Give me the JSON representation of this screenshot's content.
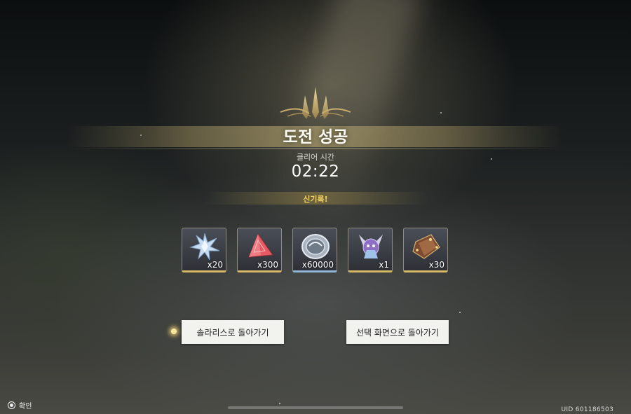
{
  "result": {
    "title": "도전 성공",
    "clear_label": "클리어 시간",
    "clear_time": "02:22",
    "record": "신기록!"
  },
  "rewards": [
    {
      "icon": "star-crystal-icon",
      "qty": "x20"
    },
    {
      "icon": "red-pyramid-crystal-icon",
      "qty": "x300"
    },
    {
      "icon": "silver-coin-icon",
      "qty": "x60000"
    },
    {
      "icon": "crystal-beast-icon",
      "qty": "x1"
    },
    {
      "icon": "brown-pouch-icon",
      "qty": "x30"
    }
  ],
  "buttons": {
    "back_to_solaris": "솔라리스로 돌아가기",
    "back_to_select": "선택 화면으로 돌아가기"
  },
  "footer": {
    "confirm_label": "확인",
    "uid": "UID  601186503"
  },
  "colors": {
    "record_text": "#f0d060",
    "gold_accent": "#d8b764",
    "blue_accent": "#8fb6d8"
  }
}
